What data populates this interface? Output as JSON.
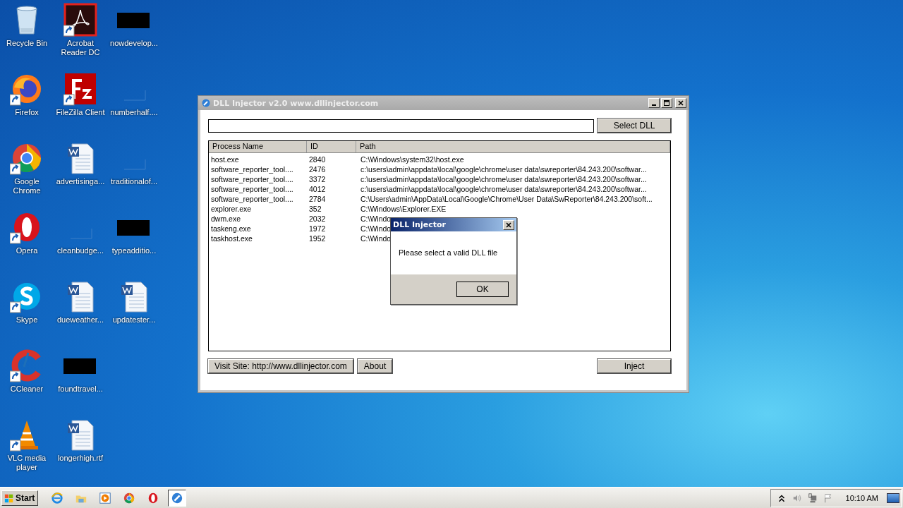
{
  "desktop_icons": [
    {
      "label": "Recycle Bin",
      "kind": "recycle",
      "shortcut": false
    },
    {
      "label": "Firefox",
      "kind": "firefox",
      "shortcut": true
    },
    {
      "label": "Google Chrome",
      "kind": "chrome",
      "shortcut": true
    },
    {
      "label": "Opera",
      "kind": "opera",
      "shortcut": true
    },
    {
      "label": "Skype",
      "kind": "skype",
      "shortcut": true
    },
    {
      "label": "CCleaner",
      "kind": "ccleaner",
      "shortcut": true
    },
    {
      "label": "VLC media player",
      "kind": "vlc",
      "shortcut": true
    },
    {
      "label": "Acrobat Reader DC",
      "kind": "acrobat",
      "shortcut": true
    },
    {
      "label": "FileZilla Client",
      "kind": "filezilla",
      "shortcut": true
    },
    {
      "label": "advertisinga...",
      "kind": "word",
      "shortcut": false
    },
    {
      "label": "cleanbudge...",
      "kind": "blank",
      "shortcut": false
    },
    {
      "label": "dueweather...",
      "kind": "word",
      "shortcut": false
    },
    {
      "label": "foundtravel...",
      "kind": "redacted",
      "shortcut": false
    },
    {
      "label": "longerhigh.rtf",
      "kind": "word",
      "shortcut": false
    },
    {
      "label": "nowdevelop...",
      "kind": "redacted",
      "shortcut": false
    },
    {
      "label": "numberhalf....",
      "kind": "blank",
      "shortcut": false
    },
    {
      "label": "traditionalof...",
      "kind": "blank",
      "shortcut": false
    },
    {
      "label": "typeadditio...",
      "kind": "redacted",
      "shortcut": false
    },
    {
      "label": "updatester...",
      "kind": "word",
      "shortcut": false
    }
  ],
  "window": {
    "title": "DLL Injector v2.0 www.dllinjector.com",
    "select_button": "Select DLL",
    "table": {
      "columns": [
        "Process Name",
        "ID",
        "Path"
      ],
      "rows": [
        [
          "host.exe",
          "2840",
          "C:\\Windows\\system32\\host.exe"
        ],
        [
          "software_reporter_tool....",
          "2476",
          "c:\\users\\admin\\appdata\\local\\google\\chrome\\user data\\swreporter\\84.243.200\\softwar..."
        ],
        [
          "software_reporter_tool....",
          "3372",
          "c:\\users\\admin\\appdata\\local\\google\\chrome\\user data\\swreporter\\84.243.200\\softwar..."
        ],
        [
          "software_reporter_tool....",
          "4012",
          "c:\\users\\admin\\appdata\\local\\google\\chrome\\user data\\swreporter\\84.243.200\\softwar..."
        ],
        [
          "software_reporter_tool....",
          "2784",
          "C:\\Users\\admin\\AppData\\Local\\Google\\Chrome\\User Data\\SwReporter\\84.243.200\\soft..."
        ],
        [
          "explorer.exe",
          "352",
          "C:\\Windows\\Explorer.EXE"
        ],
        [
          "dwm.exe",
          "2032",
          "C:\\Windo"
        ],
        [
          "taskeng.exe",
          "1972",
          "C:\\Windo"
        ],
        [
          "taskhost.exe",
          "1952",
          "C:\\Windo"
        ]
      ]
    },
    "visit_button": "Visit Site: http://www.dllinjector.com",
    "about_button": "About",
    "inject_button": "Inject"
  },
  "dialog": {
    "title": "DLL Injector",
    "message": "Please select a valid DLL file",
    "ok_button": "OK"
  },
  "taskbar": {
    "start": "Start",
    "apps": [
      {
        "kind": "ie",
        "selected": false
      },
      {
        "kind": "folder",
        "selected": false
      },
      {
        "kind": "media",
        "selected": false
      },
      {
        "kind": "chrome",
        "selected": false
      },
      {
        "kind": "opera",
        "selected": false
      },
      {
        "kind": "injector",
        "selected": true
      }
    ],
    "clock": "10:10 AM"
  }
}
